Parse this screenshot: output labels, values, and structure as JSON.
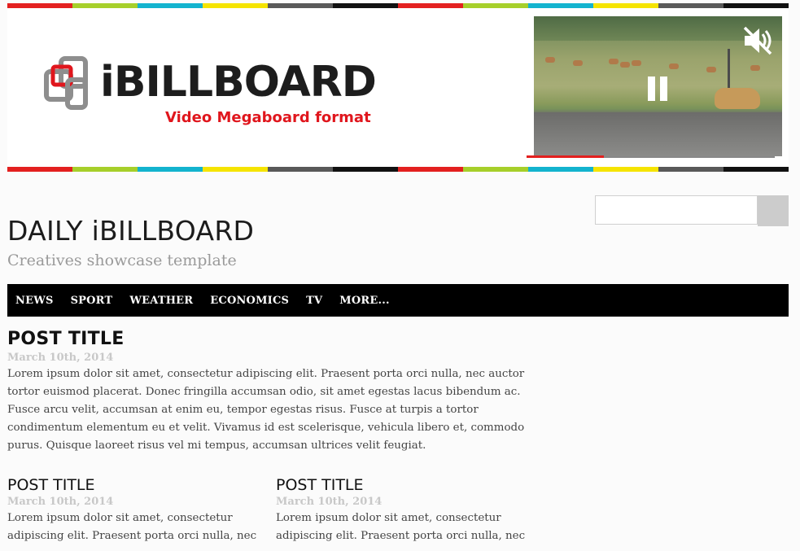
{
  "ad": {
    "logo_text": "iBILLBOARD",
    "logo_subtitle": "Video Megaboard format",
    "stripe_colors": [
      "#e3201f",
      "#a6cf2a",
      "#13b3ce",
      "#f5e400",
      "#595959",
      "#111111"
    ],
    "video": {
      "mute_icon": "speaker-muted-icon",
      "pause_icon": "pause-icon",
      "progress": 0.31
    }
  },
  "search": {
    "placeholder": "",
    "button_icon": "search-icon"
  },
  "site": {
    "title": "DAILY iBILLBOARD",
    "subtitle": "Creatives showcase template"
  },
  "nav": {
    "items": [
      {
        "label": "NEWS"
      },
      {
        "label": "SPORT"
      },
      {
        "label": "WEATHER"
      },
      {
        "label": "ECONOMICS"
      },
      {
        "label": "TV"
      },
      {
        "label": "MORE..."
      }
    ]
  },
  "posts": [
    {
      "title": "POST TITLE",
      "date": "March 10th, 2014",
      "body": "Lorem ipsum dolor sit amet, consectetur adipiscing elit. Praesent porta orci nulla, nec auctor tortor euismod placerat. Donec fringilla accumsan odio, sit amet egestas lacus bibendum ac. Fusce arcu velit, accumsan at enim eu, tempor egestas risus. Fusce at turpis a tortor condimentum elementum eu et velit. Vivamus id est scelerisque, vehicula libero et, commodo purus. Quisque laoreet risus vel mi tempus, accumsan ultrices velit feugiat."
    },
    {
      "title": "POST TITLE",
      "date": "March 10th, 2014",
      "body": "Lorem ipsum dolor sit amet, consectetur adipiscing elit. Praesent porta orci nulla, nec"
    },
    {
      "title": "POST TITLE",
      "date": "March 10th, 2014",
      "body": "Lorem ipsum dolor sit amet, consectetur adipiscing elit. Praesent porta orci nulla, nec"
    }
  ]
}
